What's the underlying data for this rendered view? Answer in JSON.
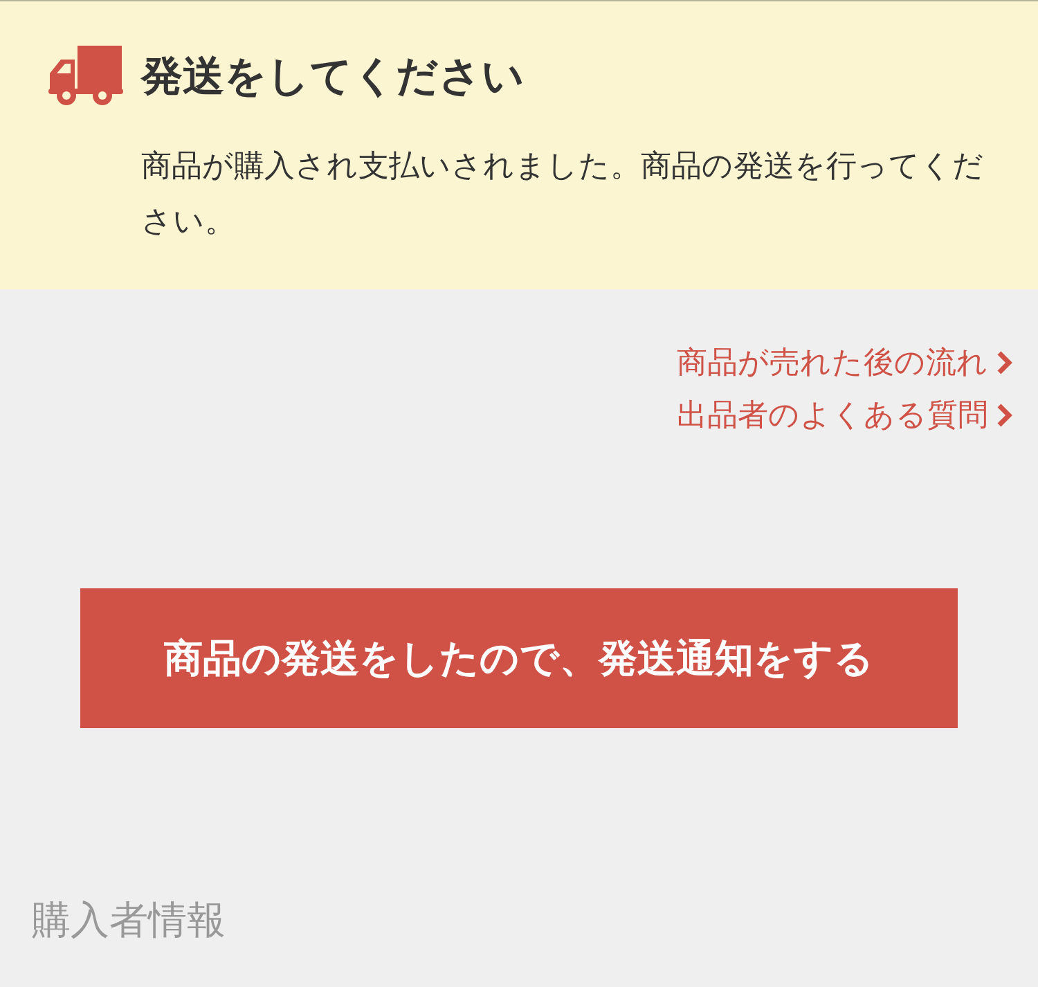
{
  "notice": {
    "title": "発送をしてください",
    "message": "商品が購入され支払いされました。商品の発送を行ってください。"
  },
  "links": [
    {
      "label": "商品が売れた後の流れ"
    },
    {
      "label": "出品者のよくある質問"
    }
  ],
  "action_button": {
    "label": "商品の発送をしたので、発送通知をする"
  },
  "section_heading": "購入者情報"
}
